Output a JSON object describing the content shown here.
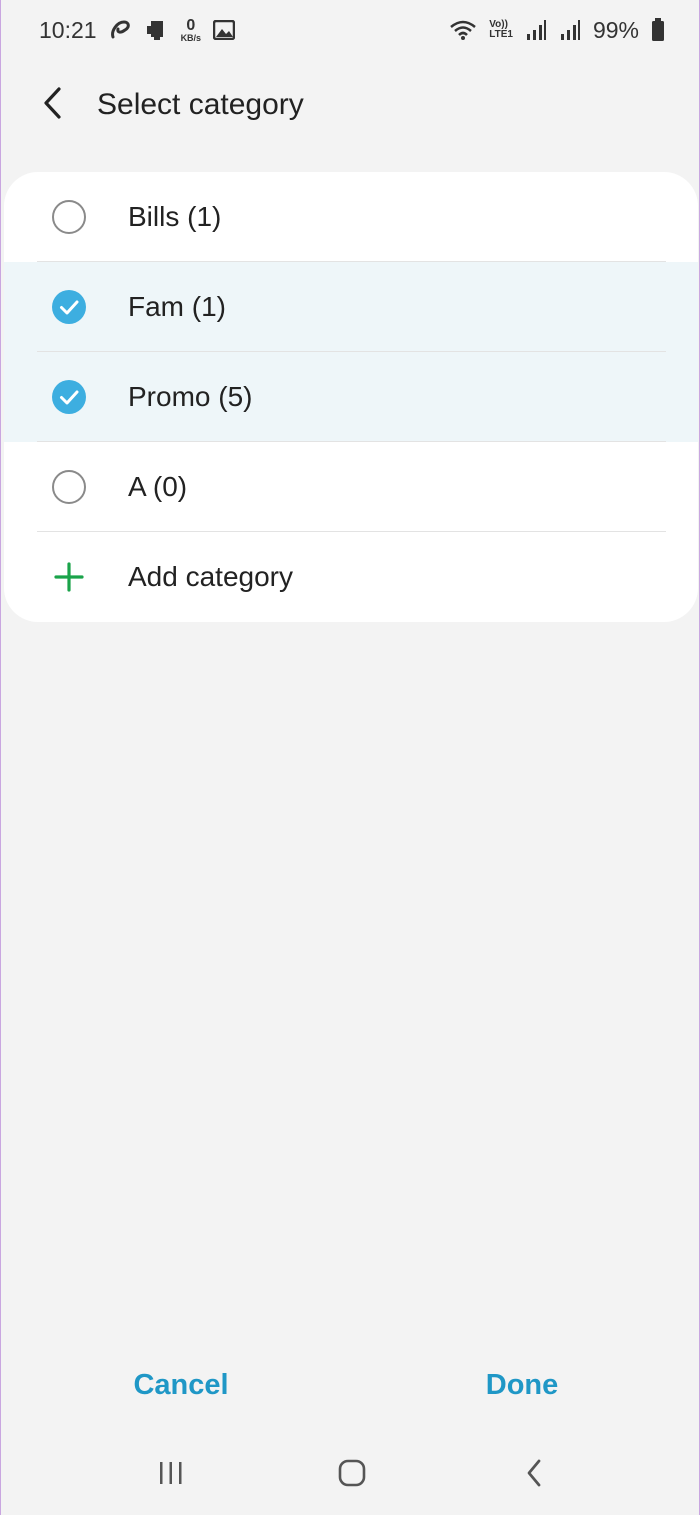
{
  "status_bar": {
    "time": "10:21",
    "speed_value": "0",
    "speed_unit": "KB/s",
    "volte_top": "Vo))",
    "volte_bottom": "LTE1",
    "battery": "99%",
    "icons": [
      "airtel-icon",
      "card-icon",
      "image-icon",
      "wifi-icon",
      "signal-icon",
      "signal-icon",
      "battery-icon"
    ]
  },
  "header": {
    "title": "Select category"
  },
  "categories": [
    {
      "label": "Bills (1)",
      "checked": false
    },
    {
      "label": "Fam (1)",
      "checked": true
    },
    {
      "label": "Promo (5)",
      "checked": true
    },
    {
      "label": "A (0)",
      "checked": false
    }
  ],
  "add_category": {
    "label": "Add category"
  },
  "actions": {
    "cancel_label": "Cancel",
    "done_label": "Done"
  },
  "colors": {
    "accent": "#1f97c6",
    "check_fill": "#3daee0",
    "add_green": "#1aa34a",
    "selected_row_bg": "#eef6f9",
    "page_bg": "#f3f3f3"
  }
}
